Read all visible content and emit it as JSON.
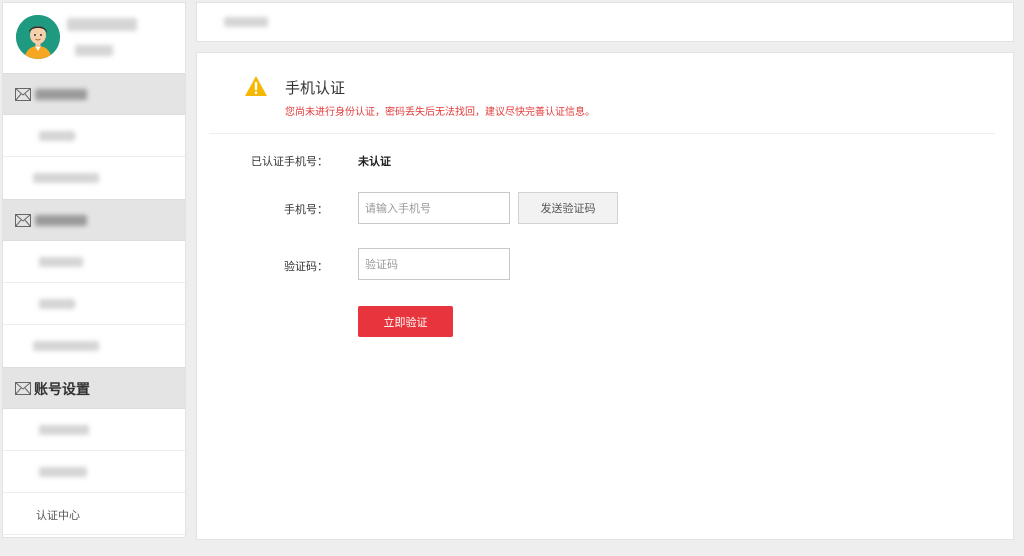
{
  "sidebar": {
    "groups": [
      {
        "label": ""
      },
      {
        "label": ""
      },
      {
        "label": "账号设置"
      }
    ],
    "auth_center_label": "认证中心"
  },
  "main": {
    "title": "手机认证",
    "notice": "您尚未进行身份认证，密码丢失后无法找回，建议尽快完善认证信息。",
    "verified_phone_label": "已认证手机号：",
    "verified_phone_value": "未认证",
    "phone_label": "手机号：",
    "phone_placeholder": "请输入手机号",
    "phone_value": "",
    "send_code_label": "发送验证码",
    "code_label": "验证码：",
    "code_placeholder": "验证码",
    "code_value": "",
    "submit_label": "立即验证"
  },
  "colors": {
    "accent": "#e8343c",
    "notice_text": "#e23b3b",
    "warning_icon": "#f5b700",
    "avatar_bg": "#1f9a80"
  },
  "icons": {
    "avatar": "user-avatar-icon",
    "group": "envelope-icon",
    "warning": "warning-triangle-icon"
  }
}
